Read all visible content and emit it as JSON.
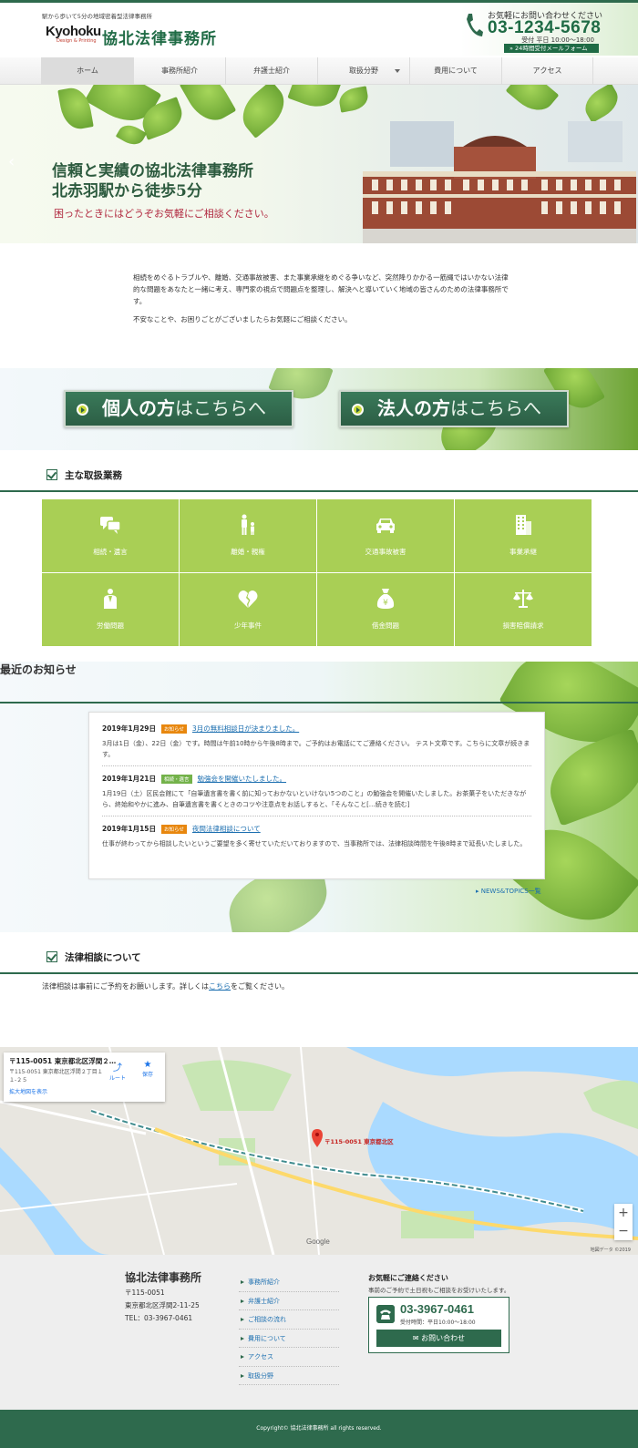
{
  "header": {
    "tagline": "駅から歩いて5分の地域密着型法律事務所",
    "logo_text": "Kyohoku",
    "logo_sub": "Design & Printing",
    "site_title": "協北法律事務所",
    "contact_lead": "お気軽にお問い合わせください",
    "tel": "03-1234-5678",
    "hours": "受付 平日 10:00～18:00",
    "mail_label": "24時間受付メールフォーム"
  },
  "nav": {
    "items": [
      {
        "label": "ホーム"
      },
      {
        "label": "事務所紹介"
      },
      {
        "label": "弁護士紹介"
      },
      {
        "label": "取扱分野"
      },
      {
        "label": "費用について"
      },
      {
        "label": "アクセス"
      }
    ]
  },
  "hero": {
    "line1": "信頼と実績の協北法律事務所",
    "line2": "北赤羽駅から徒歩5分",
    "sub": "困ったときにはどうぞお気軽にご相談ください。"
  },
  "intro": {
    "p1": "相続をめぐるトラブルや、離婚、交通事故被害、また事業承継をめぐる争いなど、突然降りかかる一筋縄ではいかない法律的な問題をあなたと一緒に考え、専門家の視点で問題点を整理し、解決へと導いていく地域の皆さんのための法律事務所です。",
    "p2": "不安なことや、お困りごとがございましたらお気軽にご相談ください。"
  },
  "cta": {
    "individual_bold": "個人の方",
    "individual_rest": "はこちらへ",
    "corporate_bold": "法人の方",
    "corporate_rest": "はこちらへ"
  },
  "services": {
    "title": "主な取扱業務",
    "items": [
      {
        "label": "相続・遺言"
      },
      {
        "label": "離婚・親権"
      },
      {
        "label": "交通事故被害"
      },
      {
        "label": "事業承継"
      },
      {
        "label": "労働問題"
      },
      {
        "label": "少年事件"
      },
      {
        "label": "借金問題"
      },
      {
        "label": "損害賠償請求"
      }
    ]
  },
  "news": {
    "title": "最近のお知らせ",
    "items": [
      {
        "date": "2019年1月29日",
        "tag": "お知らせ",
        "title": "3月の無料相談日が決まりました。",
        "body": "3月は1日（金）、22日（金）です。時間は午前10時から午後8時まで。ご予約はお電話にてご連絡ください。 テスト文章です。こちらに文章が続きます。"
      },
      {
        "date": "2019年1月21日",
        "tag": "相続・遺言",
        "title": "勉強会を開催いたしました。",
        "body": "1月19日（土）区民会館にて「自筆遺言書を書く前に知っておかないといけない5つのこと」の勉強会を開催いたしました。お茶菓子をいただきながら、終始和やかに進み、自筆遺言書を書くときのコツや注意点をお話しすると、「そんなこと[…続きを読む]"
      },
      {
        "date": "2019年1月15日",
        "tag": "お知らせ",
        "title": "夜間法律相談について",
        "body": "仕事が終わってから相談したいというご要望を多く寄せていただいておりますので、当事務所では、法律相談時間を午後8時まで延長いたしました。"
      }
    ],
    "all_link": "NEWS&TOPICS一覧"
  },
  "consult": {
    "title": "法律相談について",
    "text_before": "法律相談は事前にご予約をお願いします。詳しくは",
    "link": "こちら",
    "text_after": "をご覧ください。"
  },
  "map": {
    "card_title": "〒115-0051 東京都北区浮間２…",
    "card_addr": "〒115-0051 東京都北区浮間２丁目１１-２５",
    "card_link": "拡大地図を表示",
    "route": "ルート",
    "save": "保存",
    "pin_label": "〒115-0051 東京都北区",
    "google": "Google",
    "credit": "地図データ ©2019"
  },
  "footer": {
    "name": "協北法律事務所",
    "postal": "〒115-0051",
    "address": "東京都北区浮間2-11-25",
    "tel": "TEL：03-3967-0461",
    "links": [
      {
        "label": "事務所紹介"
      },
      {
        "label": "弁護士紹介"
      },
      {
        "label": "ご相談の流れ"
      },
      {
        "label": "費用について"
      },
      {
        "label": "アクセス"
      },
      {
        "label": "取扱分野"
      }
    ],
    "contact_lead": "お気軽にご連絡ください",
    "contact_sub": "事前のご予約で土日祝もご相談をお受けいたします。",
    "tel_big": "03-3967-0461",
    "hours": "受付時間：平日10:00～18:00",
    "btn": "お問い合わせ",
    "copyright": "Copyright© 協北法律事務所 all rights reserved."
  },
  "colors": {
    "brand": "#2e6a4d",
    "service": "#a9cf55",
    "accent": "#b0273e"
  }
}
